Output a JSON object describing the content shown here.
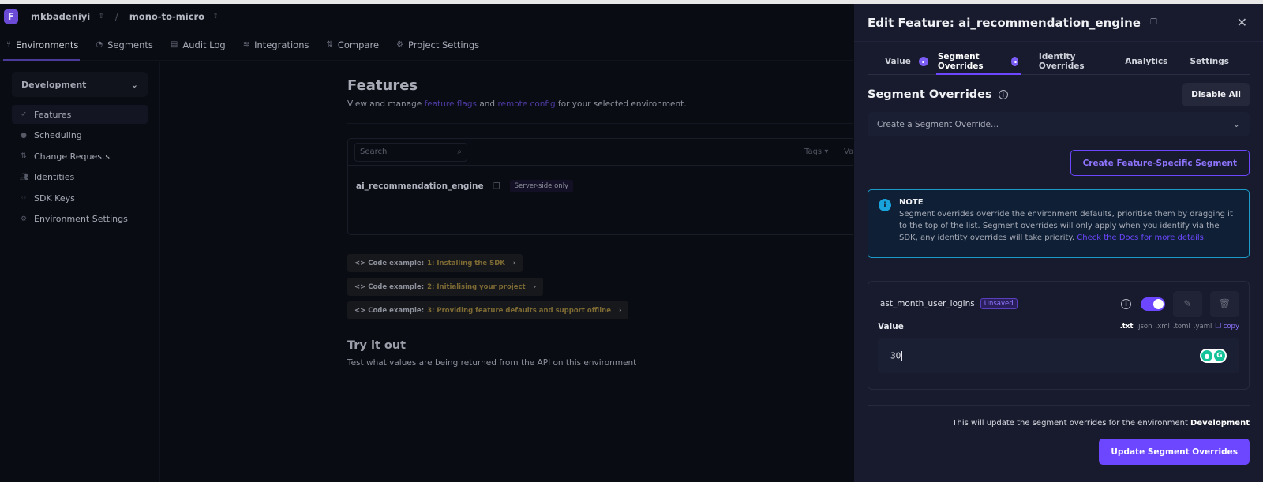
{
  "header": {
    "organisation": "mkbadeniyi",
    "separator": "/",
    "project": "mono-to-micro"
  },
  "nav": {
    "items": [
      {
        "label": "Environments",
        "icon": "environments-icon",
        "active": true
      },
      {
        "label": "Segments",
        "icon": "segments-icon"
      },
      {
        "label": "Audit Log",
        "icon": "audit-log-icon"
      },
      {
        "label": "Integrations",
        "icon": "integrations-icon"
      },
      {
        "label": "Compare",
        "icon": "compare-icon"
      },
      {
        "label": "Project Settings",
        "icon": "settings-icon"
      }
    ]
  },
  "sidebar": {
    "environment": "Development",
    "items": [
      {
        "label": "Features",
        "icon": "rocket-icon",
        "active": true
      },
      {
        "label": "Scheduling",
        "icon": "timer-icon"
      },
      {
        "label": "Change Requests",
        "icon": "change-requests-icon"
      },
      {
        "label": "Identities",
        "icon": "users-icon"
      },
      {
        "label": "SDK Keys",
        "icon": "code-icon"
      },
      {
        "label": "Environment Settings",
        "icon": "gear-icon"
      }
    ]
  },
  "main": {
    "title": "Features",
    "subtitle_pre": "View and manage ",
    "link_flags": "feature flags",
    "subtitle_mid": " and ",
    "link_config": "remote config",
    "subtitle_post": " for your selected environment.",
    "search_placeholder": "Search",
    "tags_label": "Tags",
    "value_col_label": "Va",
    "feature_row": {
      "name": "ai_recommendation_engine",
      "badge": "Server-side only"
    },
    "code_examples": [
      {
        "prefix": "<> Code example:",
        "step": "1: Installing the SDK"
      },
      {
        "prefix": "<> Code example:",
        "step": "2: Initialising your project"
      },
      {
        "prefix": "<> Code example:",
        "step": "3: Providing feature defaults and support offline"
      }
    ],
    "try_title": "Try it out",
    "try_sub": "Test what values are being returned from the API on this environment"
  },
  "drawer": {
    "title": "Edit Feature: ai_recommendation_engine",
    "tabs": [
      {
        "label": "Value",
        "dot": true
      },
      {
        "label": "Segment Overrides",
        "dot": true,
        "active": true
      },
      {
        "label": "Identity Overrides"
      },
      {
        "label": "Analytics"
      },
      {
        "label": "Settings"
      }
    ],
    "section_title": "Segment Overrides",
    "disable_all": "Disable All",
    "select_placeholder": "Create a Segment Override...",
    "create_segment": "Create Feature-Specific Segment",
    "note": {
      "title": "NOTE",
      "text": "Segment overrides override the environment defaults, prioritise them by dragging it to the top of the list. Segment overrides will only apply when you identify via the SDK, any identity overrides will take priority. ",
      "link": "Check the Docs for more details",
      "end": "."
    },
    "override": {
      "segment": "last_month_user_logins",
      "status": "Unsaved",
      "enabled": true,
      "value_label": "Value",
      "formats": [
        ".txt",
        ".json",
        ".xml",
        ".toml",
        ".yaml"
      ],
      "active_format": ".txt",
      "copy_label": "copy",
      "value": "30"
    },
    "footer_text": "This will update the segment overrides for the environment ",
    "footer_env": "Development",
    "update_button": "Update Segment Overrides"
  }
}
